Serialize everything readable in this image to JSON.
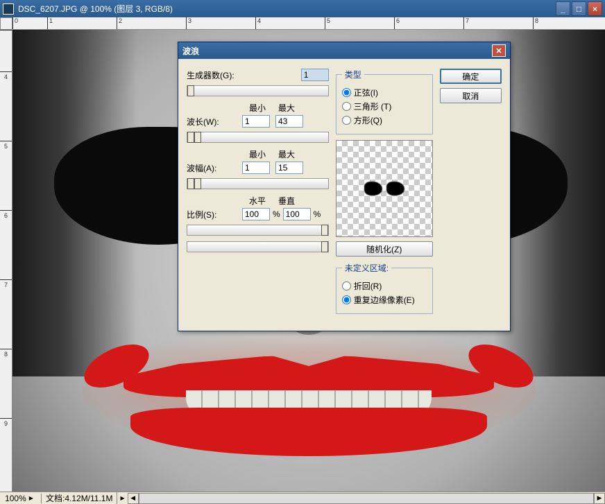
{
  "window": {
    "title": "DSC_6207.JPG @ 100% (图层 3, RGB/8)"
  },
  "ruler_h": [
    "0",
    "1",
    "2",
    "3",
    "4",
    "5",
    "6",
    "7",
    "8"
  ],
  "ruler_v": [
    "4",
    "5",
    "6",
    "7",
    "8",
    "9"
  ],
  "status": {
    "zoom": "100%",
    "doc": "文档:4.12M/11.1M"
  },
  "dialog": {
    "title": "波浪",
    "generators_label": "生成器数(G):",
    "generators_value": "1",
    "min_label": "最小",
    "max_label": "最大",
    "wavelength_label": "波长(W):",
    "wavelength_min": "1",
    "wavelength_max": "43",
    "amplitude_label": "波幅(A):",
    "amplitude_min": "1",
    "amplitude_max": "15",
    "horiz_label": "水平",
    "vert_label": "垂直",
    "scale_label": "比例(S):",
    "scale_h": "100",
    "scale_v": "100",
    "percent": "%",
    "type_legend": "类型",
    "type_sine": "正弦(I)",
    "type_triangle": "三角形 (T)",
    "type_square": "方形(Q)",
    "randomize": "随机化(Z)",
    "undef_legend": "未定义区域:",
    "undef_wrap": "折回(R)",
    "undef_repeat": "重复边缘像素(E)",
    "ok": "确定",
    "cancel": "取消"
  }
}
